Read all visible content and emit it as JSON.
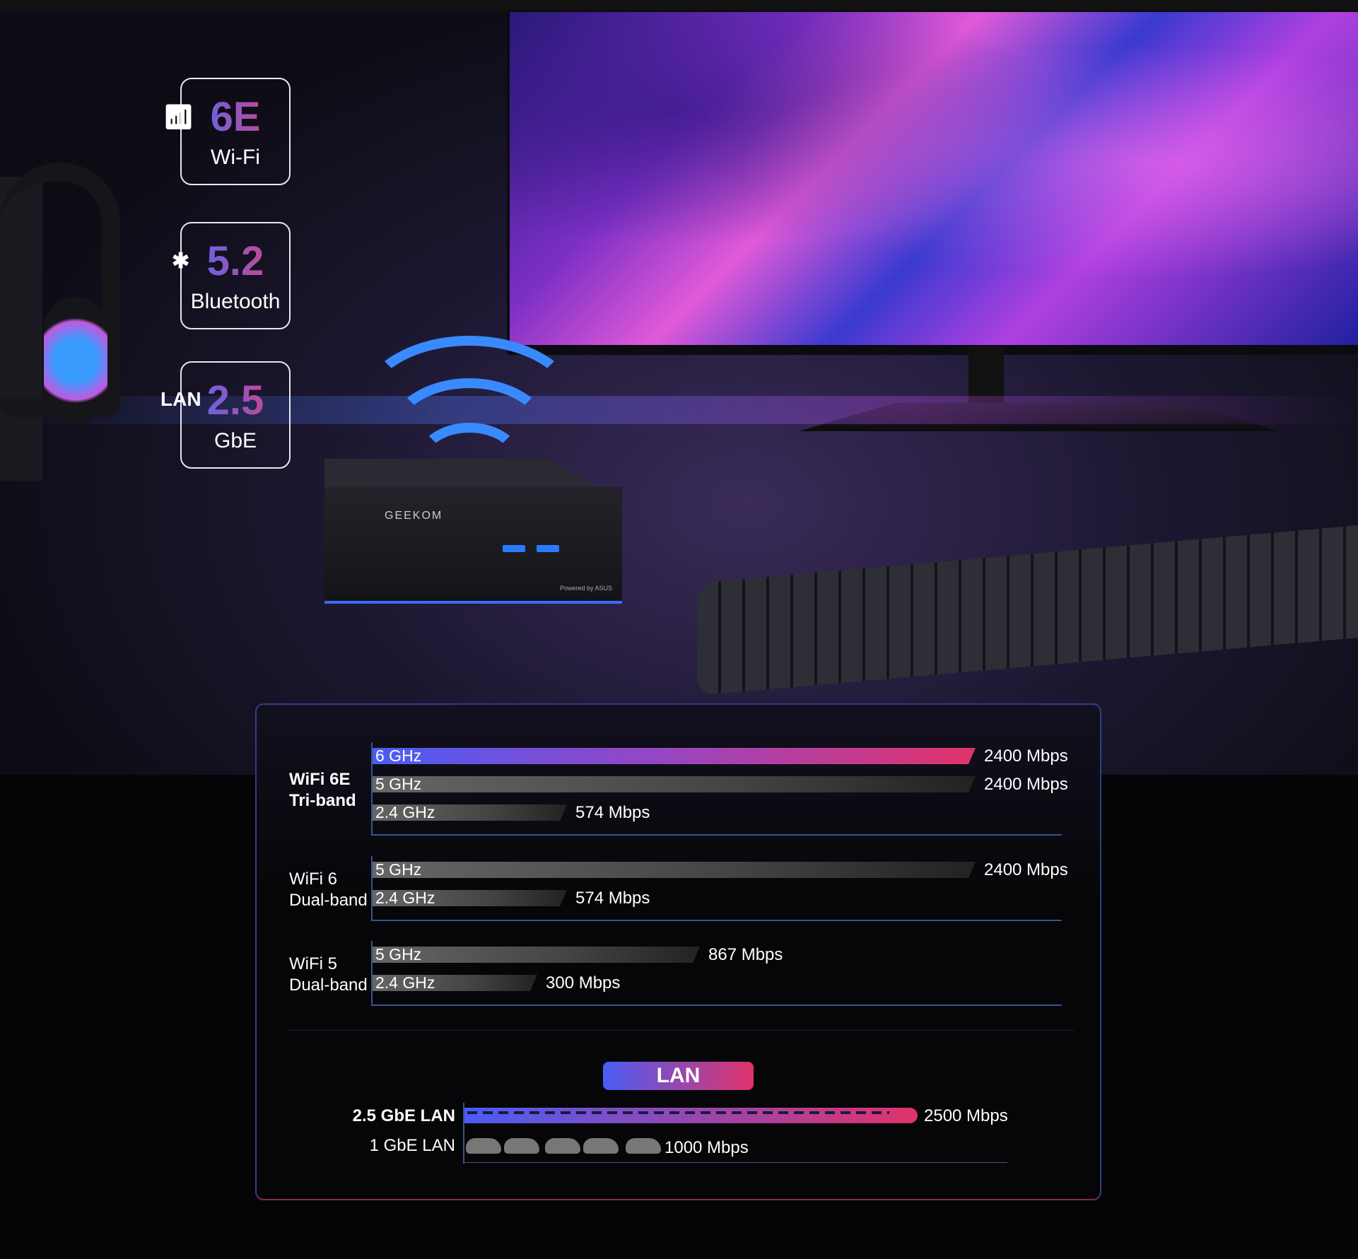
{
  "badges": [
    {
      "icon": "wifi-icon",
      "big": "6E",
      "small": "Wi-Fi"
    },
    {
      "icon": "bluetooth-icon",
      "big": "5.2",
      "small": "Bluetooth"
    },
    {
      "prefix": "LAN",
      "big": "2.5",
      "small": "GbE"
    }
  ],
  "device": {
    "brand": "GEEKOM",
    "powered": "Powered by ASUS"
  },
  "colors": {
    "gradient_start": "#4a5cf5",
    "gradient_end": "#e0336a",
    "axis": "#3a5490"
  },
  "chart_data": [
    {
      "type": "bar",
      "orientation": "horizontal",
      "unit": "Mbps",
      "groups": [
        {
          "label_line1": "WiFi 6E",
          "label_line2": "Tri-band",
          "bold": true,
          "bars": [
            {
              "band": "6 GHz",
              "value": 2400,
              "value_label": "2400 Mbps",
              "highlight": true
            },
            {
              "band": "5 GHz",
              "value": 2400,
              "value_label": "2400 Mbps"
            },
            {
              "band": "2.4 GHz",
              "value": 574,
              "value_label": "574 Mbps"
            }
          ]
        },
        {
          "label_line1": "WiFi 6",
          "label_line2": "Dual-band",
          "bars": [
            {
              "band": "5 GHz",
              "value": 2400,
              "value_label": "2400 Mbps"
            },
            {
              "band": "2.4 GHz",
              "value": 574,
              "value_label": "574 Mbps"
            }
          ]
        },
        {
          "label_line1": "WiFi 5",
          "label_line2": "Dual-band",
          "bars": [
            {
              "band": "5 GHz",
              "value": 867,
              "value_label": "867 Mbps"
            },
            {
              "band": "2.4 GHz",
              "value": 300,
              "value_label": "300 Mbps"
            }
          ]
        }
      ]
    },
    {
      "type": "bar",
      "orientation": "horizontal",
      "title": "LAN",
      "unit": "Mbps",
      "bars": [
        {
          "label": "2.5 GbE LAN",
          "value": 2500,
          "value_label": "2500 Mbps",
          "icon": "train-icon"
        },
        {
          "label": "1 GbE LAN",
          "value": 1000,
          "value_label": "1000 Mbps",
          "icon": "car-icon"
        }
      ]
    }
  ]
}
